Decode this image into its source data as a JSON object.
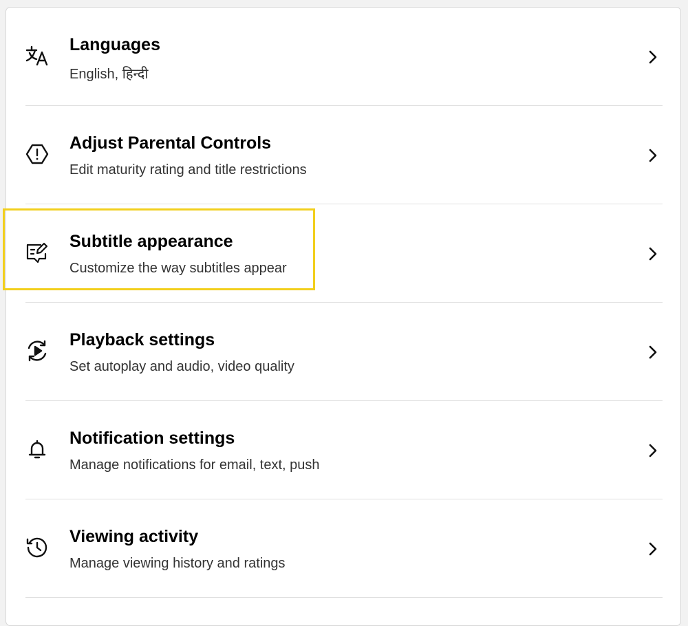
{
  "settings": {
    "items": [
      {
        "title": "Languages",
        "subtitle": "English, हिन्दी",
        "icon": "translate-icon"
      },
      {
        "title": "Adjust Parental Controls",
        "subtitle": "Edit maturity rating and title restrictions",
        "icon": "warning-hexagon-icon"
      },
      {
        "title": "Subtitle appearance",
        "subtitle": "Customize the way subtitles appear",
        "icon": "subtitle-edit-icon"
      },
      {
        "title": "Playback settings",
        "subtitle": "Set autoplay and audio, video quality",
        "icon": "playback-loop-icon"
      },
      {
        "title": "Notification settings",
        "subtitle": "Manage notifications for email, text, push",
        "icon": "bell-icon"
      },
      {
        "title": "Viewing activity",
        "subtitle": "Manage viewing history and ratings",
        "icon": "history-clock-icon"
      }
    ]
  },
  "colors": {
    "highlight": "#f2cf1d",
    "divider": "#e0e0e0"
  }
}
